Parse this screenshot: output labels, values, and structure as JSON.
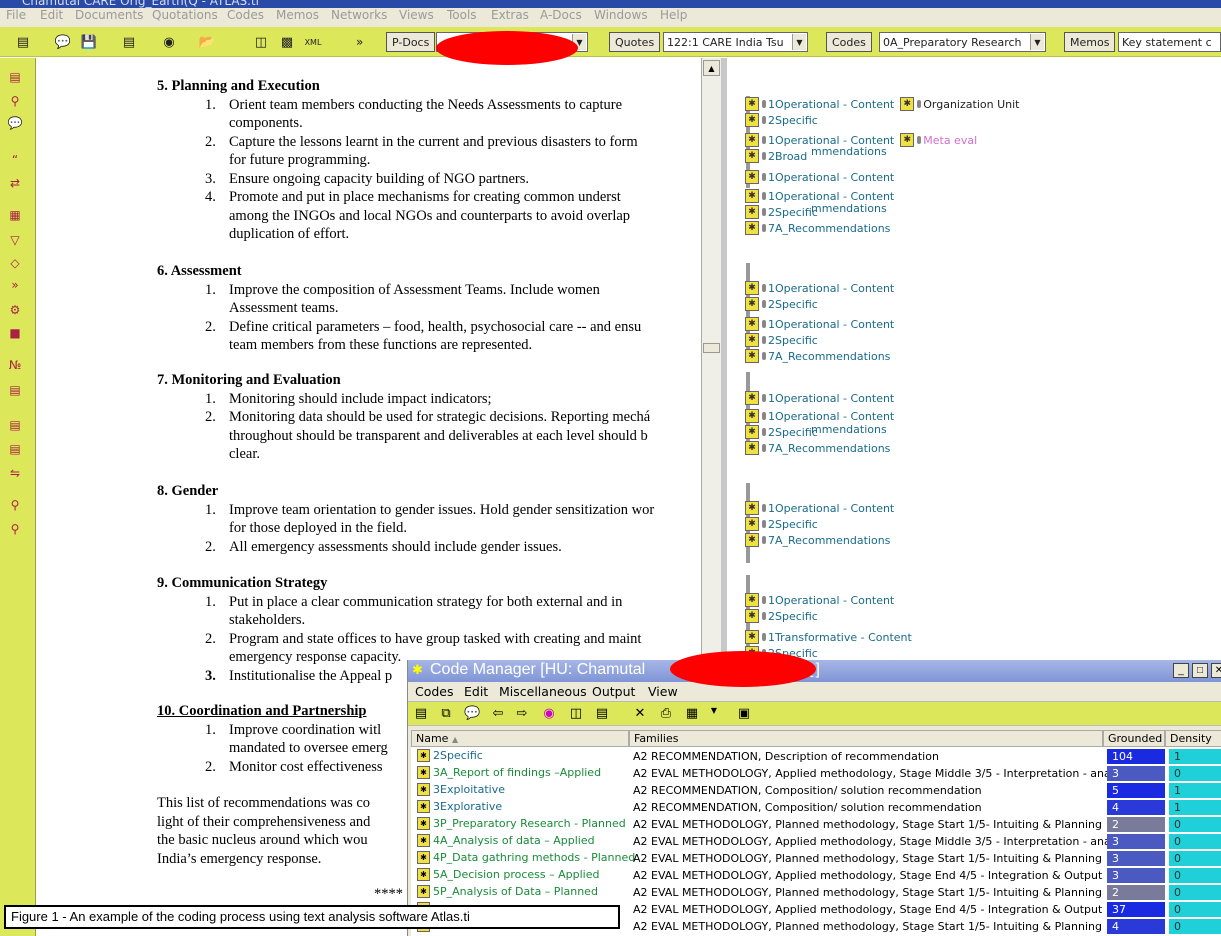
{
  "window": {
    "title": "Chamutal CARE Orig_Earth(Q - ATLAS.ti"
  },
  "menubar": [
    "File",
    "Edit",
    "Documents",
    "Quotations",
    "Codes",
    "Memos",
    "Networks",
    "Views",
    "Tools",
    "Extras",
    "A-Docs",
    "Windows",
    "Help"
  ],
  "toolbar": {
    "pdocs_label": "P-Docs",
    "quotes_label": "Quotes",
    "quote_value": "122:1 CARE India Tsu",
    "codes_label": "Codes",
    "code_value": "0A_Preparatory Research",
    "memos_label": "Memos",
    "memo_value": "Key statement c",
    "icons": [
      "primary-doc-icon",
      "comment-icon",
      "save-icon",
      "quotation-icon",
      "binoculars-icon",
      "open-folder-icon",
      "network-icon",
      "query-icon",
      "xml-icon"
    ]
  },
  "document": {
    "sections": [
      {
        "heading": "5.  Planning and Execution",
        "items": [
          {
            "num": "1.",
            "lines": [
              "Orient team members conducting the Needs Assessments to capture",
              "components."
            ]
          },
          {
            "num": "2.",
            "lines": [
              "Capture the lessons learnt in the current and previous disasters to form",
              "for future programming."
            ]
          },
          {
            "num": "3.",
            "lines": [
              "Ensure ongoing capacity building of NGO partners."
            ]
          },
          {
            "num": "4.",
            "lines": [
              "Promote and put in place mechanisms for creating common underst",
              "among the INGOs and local NGOs and counterparts to avoid overlap",
              "duplication of effort."
            ]
          }
        ]
      },
      {
        "heading": "6.  Assessment",
        "items": [
          {
            "num": "1.",
            "lines": [
              "Improve the composition of Assessment Teams.   Include women",
              "Assessment teams."
            ]
          },
          {
            "num": "2.",
            "lines": [
              "Define critical parameters – food, health, psychosocial care  -- and ensu",
              "team members from these functions are represented."
            ]
          }
        ]
      },
      {
        "heading": "7.  Monitoring and Evaluation",
        "items": [
          {
            "num": "1.",
            "lines": [
              "Monitoring should include impact indicators;"
            ]
          },
          {
            "num": "2.",
            "lines": [
              "Monitoring data should be used for strategic decisions.  Reporting mechá",
              "throughout should be transparent and deliverables at each level should b",
              "clear."
            ]
          }
        ]
      },
      {
        "heading": "8.  Gender",
        "items": [
          {
            "num": "1.",
            "lines": [
              "Improve team orientation to gender issues. Hold gender sensitization wor",
              "for those deployed in the field."
            ]
          },
          {
            "num": "2.",
            "lines": [
              "All emergency assessments should include gender issues."
            ]
          }
        ]
      },
      {
        "heading": "9.   Communication Strategy",
        "items": [
          {
            "num": "1.",
            "lines": [
              "Put in place a clear communication strategy for both external and in",
              "stakeholders."
            ]
          },
          {
            "num": "2.",
            "lines": [
              "Program and state offices to have group tasked with creating and maint",
              "emergency response capacity."
            ]
          },
          {
            "num": "3.",
            "lines": [
              "Institutionalise the Appeal p"
            ]
          }
        ]
      },
      {
        "heading": "10.  Coordination and Partnership",
        "items": [
          {
            "num": "1.",
            "lines": [
              "Improve coordination witl",
              "mandated to oversee emerg"
            ]
          },
          {
            "num": "2.",
            "lines": [
              "Monitor cost effectiveness"
            ]
          }
        ]
      }
    ],
    "closing_lines": [
      "This list of recommendations was co",
      "light of their comprehensiveness and",
      "the basic nucleus around which wou",
      "India’s emergency response."
    ],
    "stars": "****"
  },
  "margin_codes": [
    {
      "label": "1Operational - Content",
      "extra": "Organization Unit"
    },
    {
      "label": "2Specific"
    },
    {
      "label": "1Operational - Content",
      "extra": "Meta eval"
    },
    {
      "label": "2Broad"
    },
    {
      "label": "1Operational - Content"
    },
    {
      "label": "1Operational - Content"
    },
    {
      "label": "2Specific"
    },
    {
      "label": "7A_Recommendations"
    },
    {
      "label": "1Operational - Content"
    },
    {
      "label": "2Specific"
    },
    {
      "label": "1Operational - Content"
    },
    {
      "label": "2Specific"
    },
    {
      "label": "7A_Recommendations"
    },
    {
      "label": "1Operational - Content"
    },
    {
      "label": "1Operational - Content"
    },
    {
      "label": "2Specific"
    },
    {
      "label": "7A_Recommendations"
    },
    {
      "label": "1Operational - Content"
    },
    {
      "label": "2Specific"
    },
    {
      "label": "7A_Recommendations"
    },
    {
      "label": "1Operational - Content"
    },
    {
      "label": "2Specific"
    },
    {
      "label": "1Transformative - Content"
    },
    {
      "label": "2Specific"
    }
  ],
  "margin_overlaps": [
    "mmendations",
    "mmendations",
    "mmendations"
  ],
  "code_manager": {
    "title": "Code Manager [HU: Chamutal",
    "title_end": "Q]",
    "menu": [
      "Codes",
      "Edit",
      "Miscellaneous",
      "Output",
      "View"
    ],
    "columns": {
      "name": "Name",
      "families": "Families",
      "grounded": "Grounded",
      "density": "Density"
    },
    "rows": [
      {
        "name": "2Specific",
        "families": "A2 RECOMMENDATION, Description of recommendation",
        "grounded": "104",
        "density": "1",
        "gcolor": "#1a2ae0",
        "ncolor": "#1a6a8a"
      },
      {
        "name": "3A_Report of findings –Applied",
        "families": "A2 EVAL METHODOLOGY, Applied methodology, Stage Middle 3/5 - Interpretation - analysis",
        "grounded": "3",
        "density": "0",
        "gcolor": "#4a5ac0",
        "ncolor": "#1a8a3a"
      },
      {
        "name": "3Exploitative",
        "families": "A2 RECOMMENDATION, Composition/ solution recommendation",
        "grounded": "5",
        "density": "1",
        "gcolor": "#1a2ae0",
        "ncolor": "#1a6a8a"
      },
      {
        "name": "3Explorative",
        "families": "A2 RECOMMENDATION, Composition/ solution recommendation",
        "grounded": "4",
        "density": "1",
        "gcolor": "#2a3ad8",
        "ncolor": "#1a6a8a"
      },
      {
        "name": "3P_Preparatory Research - Planned",
        "families": "A2 EVAL METHODOLOGY, Planned methodology, Stage Start 1/5- Intuiting & Planning",
        "grounded": "2",
        "density": "0",
        "gcolor": "#7a7a9a",
        "ncolor": "#1a8a3a"
      },
      {
        "name": "4A_Analysis of data – Applied",
        "families": "A2 EVAL METHODOLOGY, Applied methodology, Stage Middle 3/5 - Interpretation - analysis",
        "grounded": "3",
        "density": "0",
        "gcolor": "#4a5ac0",
        "ncolor": "#1a8a3a"
      },
      {
        "name": "4P_Data gathring methods - Planned",
        "families": "A2 EVAL METHODOLOGY, Planned methodology, Stage Start 1/5- Intuiting & Planning",
        "grounded": "3",
        "density": "0",
        "gcolor": "#4a5ac0",
        "ncolor": "#1a8a3a"
      },
      {
        "name": "5A_Decision process – Applied",
        "families": "A2 EVAL METHODOLOGY, Applied methodology, Stage End 4/5 - Integration & Output",
        "grounded": "3",
        "density": "0",
        "gcolor": "#4a5ac0",
        "ncolor": "#1a8a3a"
      },
      {
        "name": "5P_Analysis of Data – Planned",
        "families": "A2 EVAL METHODOLOGY, Planned methodology, Stage Start 1/5- Intuiting & Planning",
        "grounded": "2",
        "density": "0",
        "gcolor": "#7a7a9a",
        "ncolor": "#1a8a3a"
      },
      {
        "name": "",
        "families": "A2 EVAL METHODOLOGY, Applied methodology, Stage End 4/5 - Integration & Output",
        "grounded": "37",
        "density": "0",
        "gcolor": "#1a2ae0",
        "ncolor": "#1a8a3a"
      },
      {
        "name": "",
        "families": "A2 EVAL METHODOLOGY, Planned methodology, Stage Start 1/5- Intuiting & Planning",
        "grounded": "4",
        "density": "0",
        "gcolor": "#2a3ad8",
        "ncolor": "#1a8a3a"
      }
    ]
  },
  "caption": "Figure 1 - An example of the coding process using text analysis software Atlas.ti"
}
